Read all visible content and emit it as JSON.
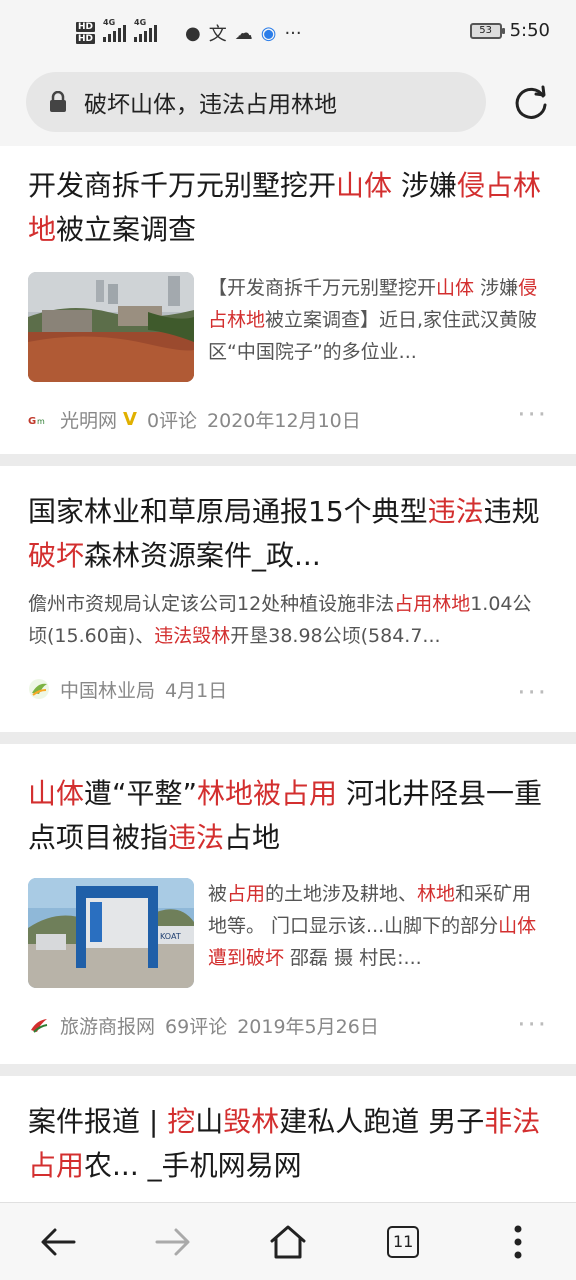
{
  "status_bar": {
    "hd1": "HD",
    "hd2": "HD",
    "net1": "4G",
    "net2": "4G",
    "battery": "53",
    "time": "5:50"
  },
  "address_bar": {
    "query": "破坏山体，违法占用林地"
  },
  "results": [
    {
      "title_parts": [
        {
          "t": "开发商拆千万元别墅挖开",
          "h": false
        },
        {
          "t": "山体",
          "h": true
        },
        {
          "t": " 涉嫌",
          "h": false
        },
        {
          "t": "侵占林地",
          "h": true
        },
        {
          "t": "被立案调查",
          "h": false
        }
      ],
      "snippet_parts": [
        {
          "t": "【开发商拆千万元别墅挖开",
          "h": false
        },
        {
          "t": "山体",
          "h": true
        },
        {
          "t": " 涉嫌",
          "h": false
        },
        {
          "t": "侵占林地",
          "h": true
        },
        {
          "t": "被立案调查】近日,家住武汉黄陂区“中国院子”的多位业...",
          "h": false
        }
      ],
      "source": "光明网",
      "verified": "V",
      "comments": "0评论",
      "date": "2020年12月10日",
      "thumbnail": "demolished-villa-hillside"
    },
    {
      "title_parts": [
        {
          "t": "国家林业和草原局通报15个典型",
          "h": false
        },
        {
          "t": "违法",
          "h": true
        },
        {
          "t": "违规",
          "h": false
        },
        {
          "t": "破坏",
          "h": true
        },
        {
          "t": "森林资源案件_政...",
          "h": false
        }
      ],
      "snippet_parts": [
        {
          "t": "儋州市资规局认定该公司12处种植设施非法",
          "h": false
        },
        {
          "t": "占用林地",
          "h": true
        },
        {
          "t": "1.04公顷(15.60亩)、",
          "h": false
        },
        {
          "t": "违法毁林",
          "h": true
        },
        {
          "t": "开垦38.98公顷(584.7...",
          "h": false
        }
      ],
      "source": "中国林业局",
      "date": "4月1日"
    },
    {
      "title_parts": [
        {
          "t": "山体",
          "h": true
        },
        {
          "t": "遭“平整”",
          "h": false
        },
        {
          "t": "林地被占用",
          "h": true
        },
        {
          "t": " 河北井陉县一重点项目被指",
          "h": false
        },
        {
          "t": "违法",
          "h": true
        },
        {
          "t": "占地",
          "h": false
        }
      ],
      "snippet_parts": [
        {
          "t": "被",
          "h": false
        },
        {
          "t": "占用",
          "h": true
        },
        {
          "t": "的土地涉及耕地、",
          "h": false
        },
        {
          "t": "林地",
          "h": true
        },
        {
          "t": "和采矿用地等。 门口显示该...山脚下的部分",
          "h": false
        },
        {
          "t": "山体遭到破坏",
          "h": true
        },
        {
          "t": " 邵磊 摄 村民:...",
          "h": false
        }
      ],
      "source": "旅游商报网",
      "comments": "69评论",
      "date": "2019年5月26日",
      "thumbnail": "construction-site-gate"
    },
    {
      "title_parts": [
        {
          "t": "案件报道 | ",
          "h": false
        },
        {
          "t": "挖",
          "h": true
        },
        {
          "t": "山",
          "h": false
        },
        {
          "t": "毁林",
          "h": true
        },
        {
          "t": "建私人跑道 男子",
          "h": false
        },
        {
          "t": "非法占用",
          "h": true
        },
        {
          "t": "农... _手机网易网",
          "h": false
        }
      ]
    }
  ],
  "bottom_nav": {
    "tab_count": "11"
  },
  "colors": {
    "highlight": "#d32f2f",
    "background": "#ebebeb"
  }
}
